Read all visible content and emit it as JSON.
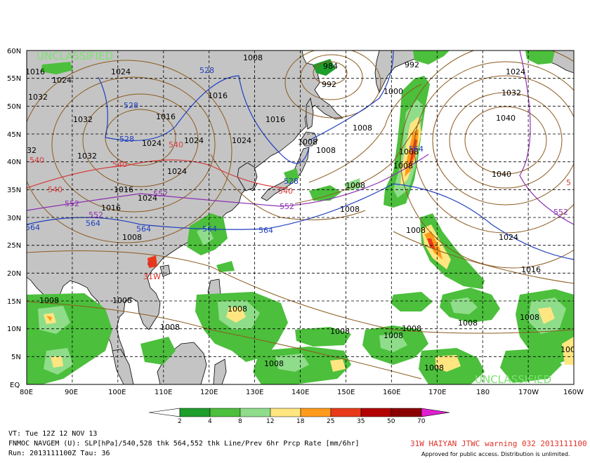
{
  "map": {
    "classification_top": "UNCLASSIFIED",
    "classification_bottom": "UNCLASSIFIED",
    "lat_labels": [
      "60N",
      "55N",
      "50N",
      "45N",
      "40N",
      "35N",
      "30N",
      "25N",
      "20N",
      "15N",
      "10N",
      "5N",
      "EQ"
    ],
    "lon_labels": [
      "80E",
      "90E",
      "100E",
      "110E",
      "120E",
      "130E",
      "140E",
      "150E",
      "160E",
      "170E",
      "180",
      "170W",
      "160W"
    ],
    "pressure_labels": [
      "1008",
      "1016",
      "1024",
      "1032",
      "1016",
      "1024",
      "1016",
      "1016",
      "1024",
      "1032",
      "1024",
      "1032",
      "1024",
      "1016",
      "1024",
      "1008",
      "1008",
      "1016",
      "1024",
      "1008",
      "984",
      "992",
      "992",
      "1000",
      "1008",
      "1008",
      "1008",
      "1008",
      "1008",
      "1024",
      "1032",
      "1040",
      "1040",
      "1024",
      "1016",
      "1008",
      "1008",
      "1008",
      "1008",
      "1008",
      "1008",
      "1008",
      "1008",
      "1008",
      "1008",
      "1008",
      "1008",
      "100"
    ],
    "height_labels": [
      {
        "text": "528",
        "color": "#1f3fbf"
      },
      {
        "text": "528",
        "color": "#1f3fbf"
      },
      {
        "text": "528",
        "color": "#1f3fbf"
      },
      {
        "text": "528",
        "color": "#1f3fbf"
      },
      {
        "text": "540",
        "color": "#d83c3c"
      },
      {
        "text": "540",
        "color": "#d83c3c"
      },
      {
        "text": "540",
        "color": "#d83c3c"
      },
      {
        "text": "540",
        "color": "#d83c3c"
      },
      {
        "text": "540",
        "color": "#d83c3c"
      },
      {
        "text": "552",
        "color": "#8b2fb0"
      },
      {
        "text": "552",
        "color": "#8b2fb0"
      },
      {
        "text": "552",
        "color": "#8b2fb0"
      },
      {
        "text": "552",
        "color": "#8b2fb0"
      },
      {
        "text": "552",
        "color": "#8b2fb0"
      },
      {
        "text": "564",
        "color": "#1f3fbf"
      },
      {
        "text": "564",
        "color": "#1f3fbf"
      },
      {
        "text": "564",
        "color": "#1f3fbf"
      },
      {
        "text": "564",
        "color": "#1f3fbf"
      },
      {
        "text": "564",
        "color": "#1f3fbf"
      },
      {
        "text": "564",
        "color": "#1f3fbf"
      },
      {
        "text": "32",
        "color": "#000000"
      },
      {
        "text": "5",
        "color": "#d83c3c"
      }
    ],
    "storm_marker": {
      "label": "31W",
      "color": "#e0332a"
    },
    "colors": {
      "land": "#c4c4c4",
      "ocean": "#ffffff",
      "isobar": "#8b5a1e",
      "precip": [
        "#1e9e2b",
        "#4cbf3c",
        "#8fdd8a",
        "#ffe680",
        "#ff9a1a",
        "#e83a1a",
        "#b30000",
        "#8a0000",
        "#e020d0"
      ]
    }
  },
  "colorbar": {
    "ticks": [
      "2",
      "4",
      "8",
      "12",
      "18",
      "25",
      "35",
      "50",
      "70"
    ]
  },
  "footer": {
    "line1": "VT: Tue 12Z 12 NOV 13",
    "line2": "FNMOC NAVGEM (U): SLP[hPa]/540,528 thk 564,552 thk Line/Prev 6hr Prcp Rate [mm/6hr]",
    "line3": "Run: 2013111100Z Tau: 36",
    "warning": "31W HAIYAN JTWC warning 032 2013111100",
    "note": "Approved for public access. Distribution is unlimited."
  }
}
